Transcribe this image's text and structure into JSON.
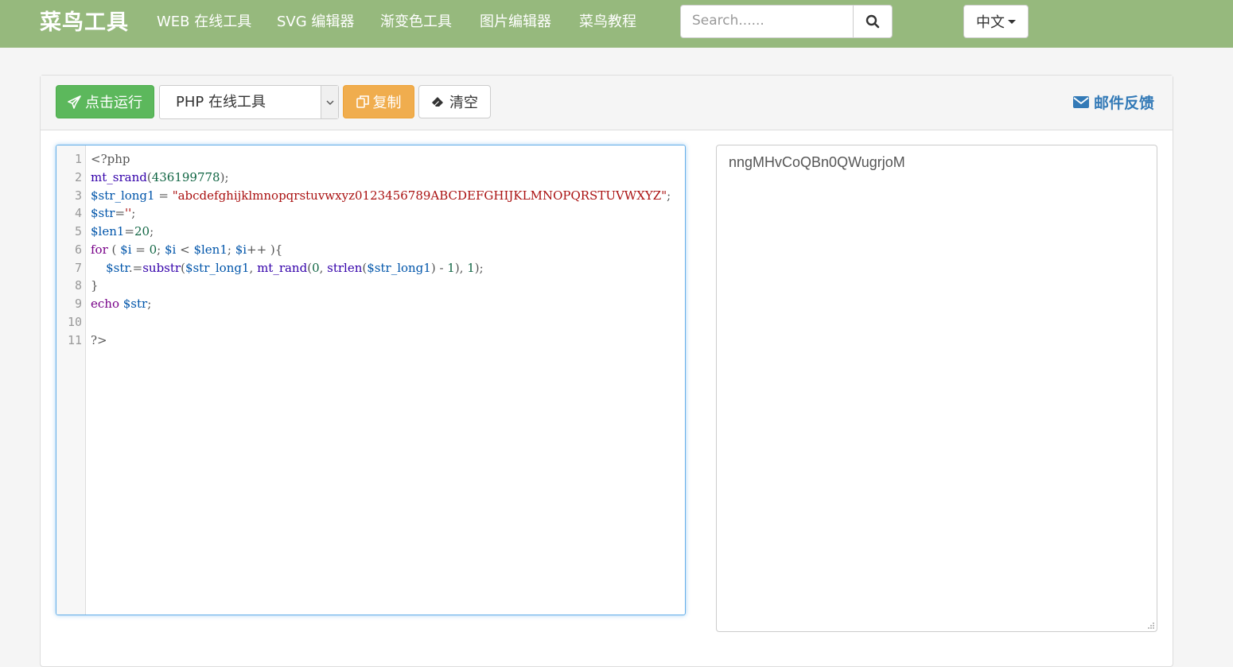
{
  "navbar": {
    "brand": "菜鸟工具",
    "links": [
      "WEB 在线工具",
      "SVG 编辑器",
      "渐变色工具",
      "图片编辑器",
      "菜鸟教程"
    ],
    "search_placeholder": "Search......",
    "search_icon": "search-icon",
    "language": "中文",
    "bg_color": "#96b97d"
  },
  "toolbar": {
    "run_label": "点击运行",
    "run_icon": "paper-plane-icon",
    "language_select": "PHP 在线工具",
    "copy_label": "复制",
    "copy_icon": "copy-icon",
    "clear_label": "清空",
    "clear_icon": "eraser-icon",
    "feedback_label": "邮件反馈",
    "feedback_icon": "envelope-icon",
    "colors": {
      "run": "#5cb85c",
      "copy": "#f0ad4e",
      "link": "#337ab7"
    }
  },
  "editor": {
    "line_numbers": [
      "1",
      "2",
      "3",
      "4",
      "5",
      "6",
      "7",
      "8",
      "9",
      "10",
      "11"
    ],
    "lines": [
      "<?php",
      "mt_srand(436199778);",
      "$str_long1 = \"abcdefghijklmnopqrstuvwxyz0123456789ABCDEFGHIJKLMNOPQRSTUVWXYZ\";",
      "$str='';",
      "$len1=20;",
      "for ( $i = 0; $i < $len1; $i++ ){",
      "    $str.=substr($str_long1, mt_rand(0, strlen($str_long1) - 1), 1);",
      "}",
      "echo $str;",
      "",
      "?>"
    ]
  },
  "output": {
    "text": "nngMHvCoQBn0QWugrjoM"
  }
}
